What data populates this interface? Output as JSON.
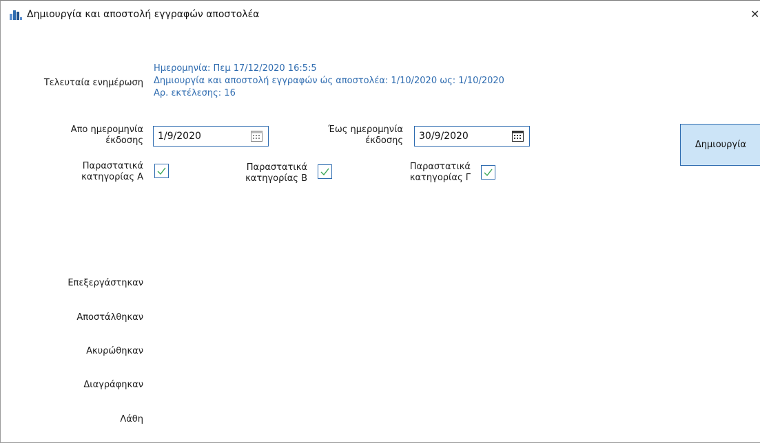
{
  "window": {
    "title": "Δημιουργία και αποστολή εγγραφών αποστολέα",
    "close_glyph": "✕"
  },
  "last_update": {
    "label": "Τελευταία ενημέρωση",
    "date_line": "Ημερομηνία: Πεμ 17/12/2020 16:5:5",
    "range_line": "Δημιουργία και αποστολή εγγραφών ώς αποστολέα: 1/10/2020 ως: 1/10/2020",
    "runs_line": "Αρ. εκτέλεσης: 16"
  },
  "from_date": {
    "label_line1": "Απο ημερομηνία",
    "label_line2": "έκδοσης",
    "value": "1/9/2020"
  },
  "to_date": {
    "label_line1": "Έως ημερομηνία",
    "label_line2": "έκδοσης",
    "value": "30/9/2020"
  },
  "categories": [
    {
      "line1": "Παραστατικά",
      "line2": "κατηγορίας Α",
      "checked": true
    },
    {
      "line1": "Παραστατικά",
      "line2": "κατηγορίας Β",
      "checked": true
    },
    {
      "line1": "Παραστατικά",
      "line2": "κατηγορίας Γ",
      "checked": true
    }
  ],
  "create_button": {
    "label": "Δημιουργία"
  },
  "stats": {
    "processed": "Επεξεργάστηκαν",
    "sent": "Αποστάλθηκαν",
    "cancelled": "Ακυρώθηκαν",
    "deleted": "Διαγράφηκαν",
    "errors": "Λάθη"
  },
  "colors": {
    "accent": "#2f6cb0",
    "button_bg": "#cce4f7",
    "check": "#3aa655"
  },
  "icons": {
    "app": "bar-chart-icon",
    "calendar": "calendar-icon",
    "check": "checkmark-icon",
    "close": "close-icon"
  }
}
